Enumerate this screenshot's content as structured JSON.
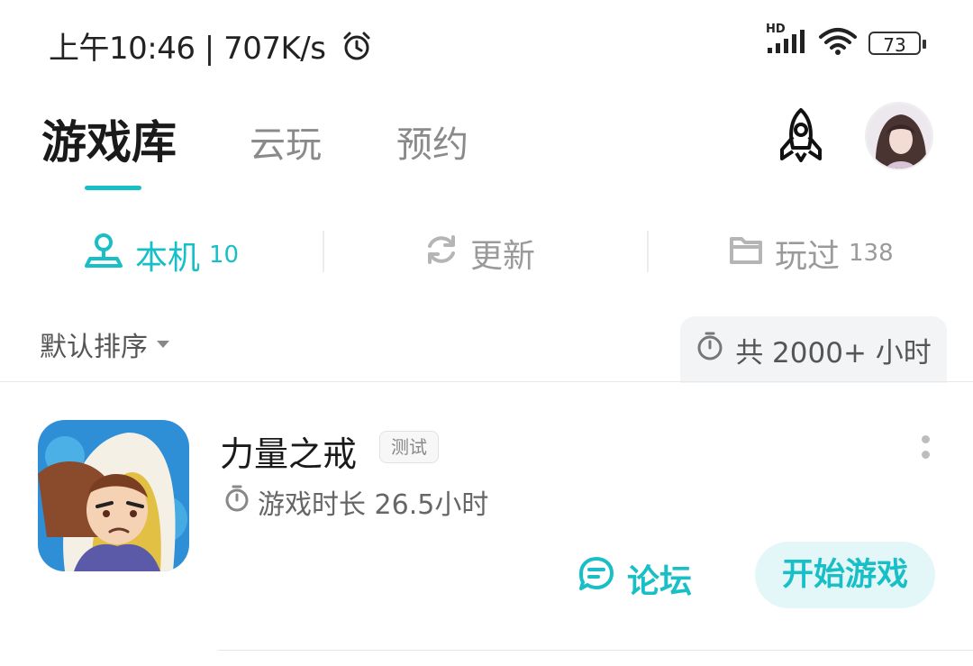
{
  "status_bar": {
    "time": "上午10:46",
    "network_speed": "707K/s",
    "alarm_icon": "alarm-clock-icon",
    "signal_label": "HD",
    "battery": "73"
  },
  "header": {
    "tabs": [
      {
        "label": "游戏库",
        "active": true
      },
      {
        "label": "云玩",
        "active": false
      },
      {
        "label": "预约",
        "active": false
      }
    ],
    "rocket_icon": "rocket-icon",
    "accent_color": "#18bfc7"
  },
  "segments": [
    {
      "label": "本机",
      "count": "10",
      "icon": "location-pin-icon",
      "active": true
    },
    {
      "label": "更新",
      "count": "",
      "icon": "refresh-icon",
      "active": false
    },
    {
      "label": "玩过",
      "count": "138",
      "icon": "folder-icon",
      "active": false
    }
  ],
  "sort": {
    "label": "默认排序"
  },
  "total_time": {
    "label": "共 2000+ 小时"
  },
  "games": [
    {
      "title": "力量之戒",
      "tag": "测试",
      "playtime": "游戏时长 26.5小时",
      "forum_label": "论坛",
      "start_label": "开始游戏"
    }
  ]
}
